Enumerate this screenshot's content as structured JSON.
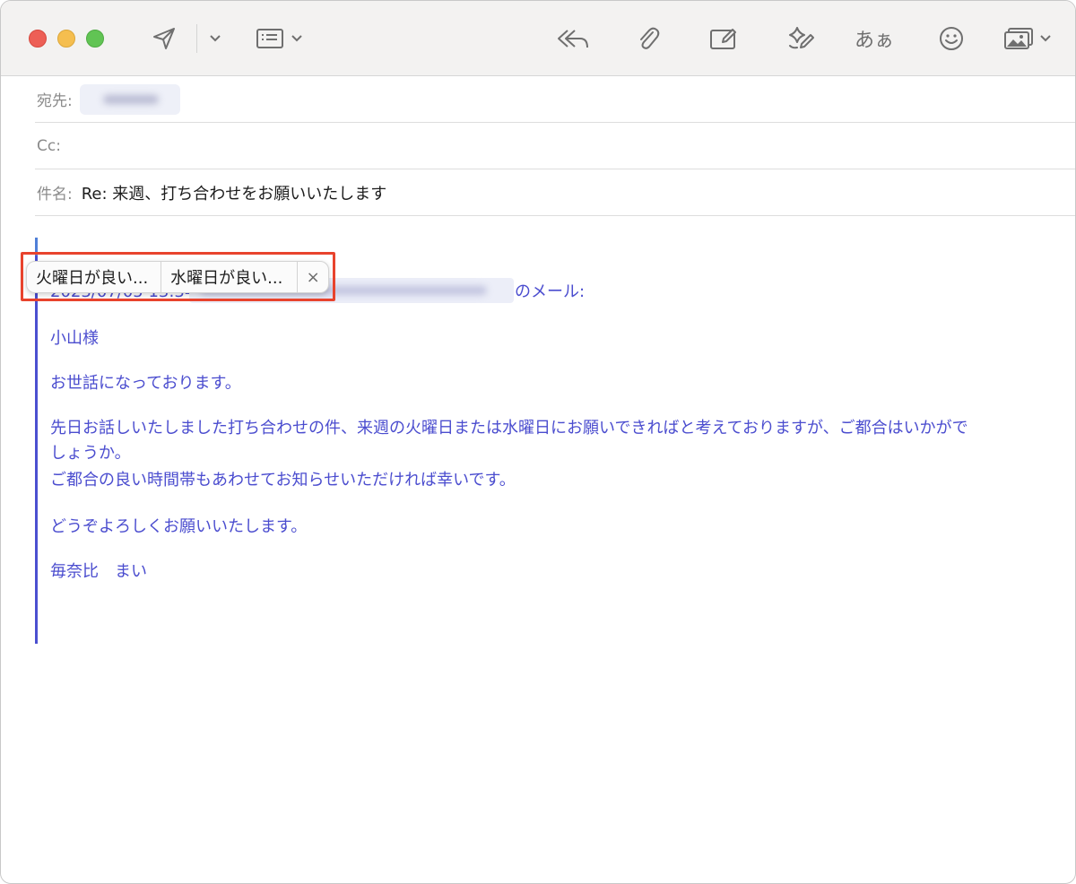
{
  "toolbar": {
    "send_icon": "paper-plane-icon",
    "send_options_icon": "chevron-down-icon",
    "header_fields_icon": "list-icon",
    "reply_all_icon": "reply-all-icon",
    "attach_icon": "paperclip-icon",
    "markup_icon": "pencil-square-icon",
    "writing_tools_icon": "sparkle-pen-icon",
    "format_label": "あぁ",
    "emoji_icon": "smiley-icon",
    "photo_icon": "photo-icon"
  },
  "header": {
    "to_label": "宛先:",
    "cc_label": "Cc:",
    "subject_label": "件名:",
    "subject_value": "Re: 来週、打ち合わせをお願いいたします"
  },
  "suggestions": {
    "chip1": "火曜日が良い...",
    "chip2": "水曜日が良い...",
    "close": "×"
  },
  "quote": {
    "date_partial": "2023/07/05 13:34、",
    "header_suffix": "のメール:",
    "salutation": "小山様",
    "greeting": "お世話になっております。",
    "para1_line1": "先日お話しいたしました打ち合わせの件、来週の火曜日または水曜日にお願いできればと考えておりますが、ご都合はいかがで",
    "para1_line2": "しょうか。",
    "para1_line3": "ご都合の良い時間帯もあわせてお知らせいただければ幸いです。",
    "closing": "どうぞよろしくお願いいたします。",
    "signature": "毎奈比　まい"
  },
  "colors": {
    "quote_text": "#4b4dcf",
    "highlight": "#e8432d"
  }
}
